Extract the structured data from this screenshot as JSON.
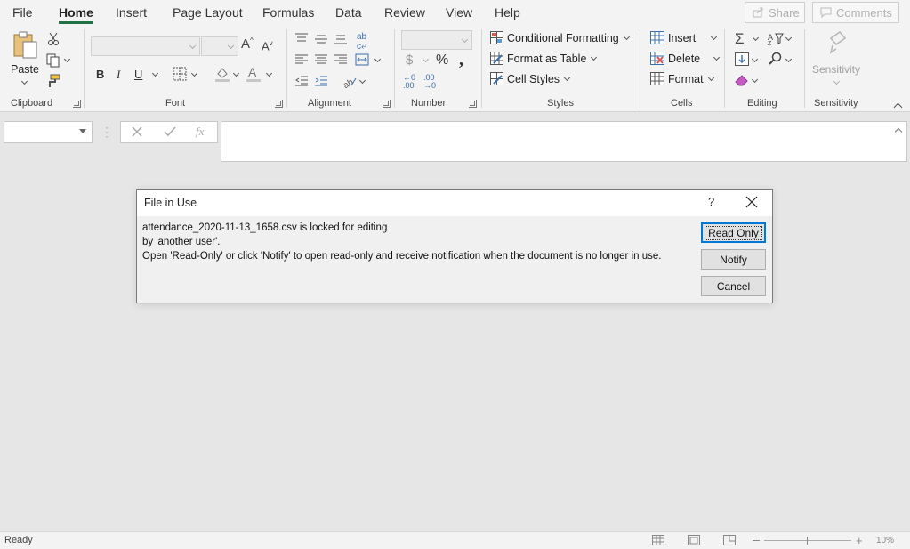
{
  "menu": {
    "tabs": [
      "File",
      "Home",
      "Insert",
      "Page Layout",
      "Formulas",
      "Data",
      "Review",
      "View",
      "Help"
    ],
    "active_tab": "Home",
    "share_label": "Share",
    "comments_label": "Comments"
  },
  "ribbon": {
    "clipboard": {
      "paste_label": "Paste",
      "group_label": "Clipboard"
    },
    "font": {
      "group_label": "Font"
    },
    "alignment": {
      "group_label": "Alignment"
    },
    "number": {
      "group_label": "Number"
    },
    "styles": {
      "conditional_formatting": "Conditional Formatting",
      "format_as_table": "Format as Table",
      "cell_styles": "Cell Styles",
      "group_label": "Styles"
    },
    "cells": {
      "insert": "Insert",
      "delete": "Delete",
      "format": "Format",
      "group_label": "Cells"
    },
    "editing": {
      "group_label": "Editing"
    },
    "sensitivity": {
      "button_label": "Sensitivity",
      "group_label": "Sensitivity"
    }
  },
  "formula_bar": {
    "fx_label": "fx",
    "name_box_value": "",
    "formula_value": ""
  },
  "dialog": {
    "title": "File in Use",
    "help_label": "?",
    "message_line1": "attendance_2020-11-13_1658.csv is locked for editing",
    "message_line2": "by 'another user'.",
    "message_line3": "Open 'Read-Only' or click 'Notify' to open read-only and receive notification when the document is no longer in use.",
    "read_only_label": "Read Only",
    "notify_label": "Notify",
    "cancel_label": "Cancel"
  },
  "status": {
    "ready_label": "Ready",
    "zoom_label": "10%"
  },
  "colors": {
    "accent_green": "#217346",
    "focus_blue": "#0078d7",
    "background": "#e6e6e6"
  }
}
